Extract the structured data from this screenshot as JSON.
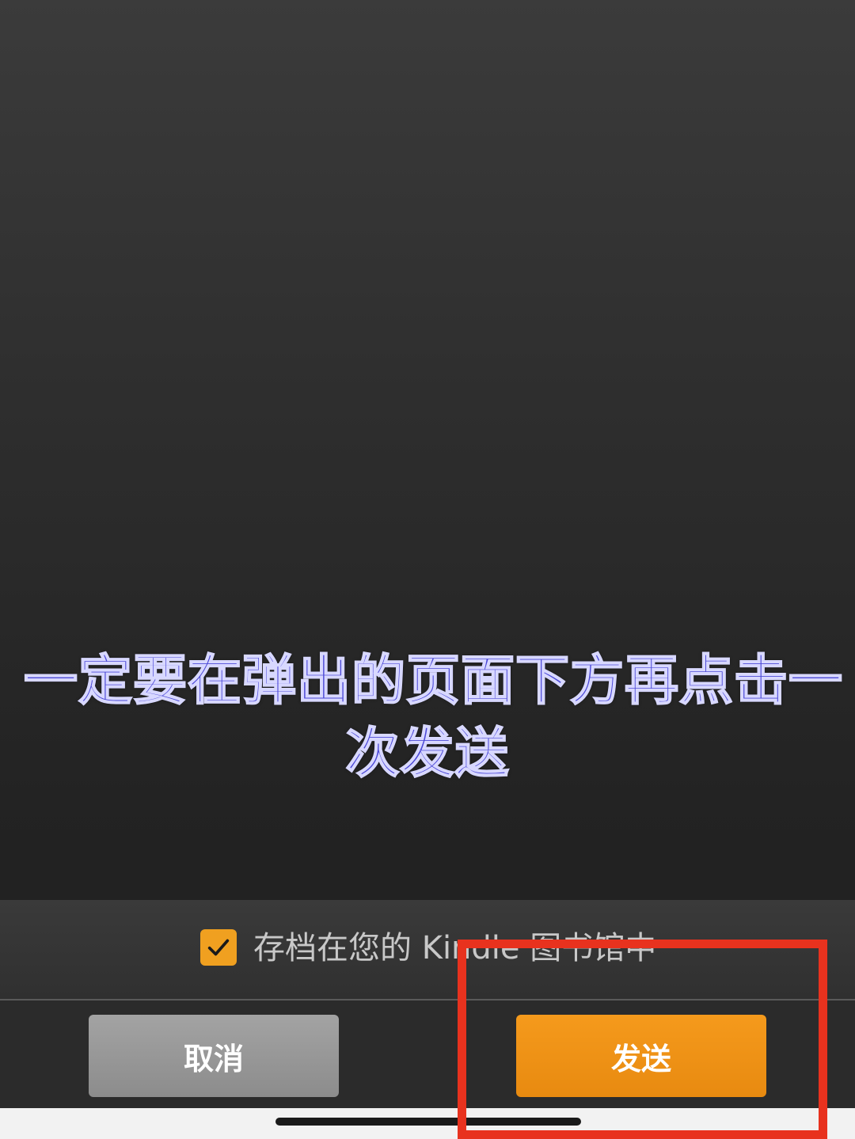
{
  "overlay": {
    "caption_line1": "一定要在弹出的页面下方再点击一",
    "caption_line2": "次发送"
  },
  "archive_option": {
    "checked": true,
    "label": "存档在您的 Kindle 图书馆中"
  },
  "buttons": {
    "cancel_label": "取消",
    "send_label": "发送"
  },
  "colors": {
    "accent": "#f0a020",
    "send_button": "#f0941a",
    "cancel_button": "#989898",
    "highlight": "#e8321e",
    "caption": "#4a47d6"
  },
  "icons": {
    "checkbox": "checkmark-icon"
  }
}
